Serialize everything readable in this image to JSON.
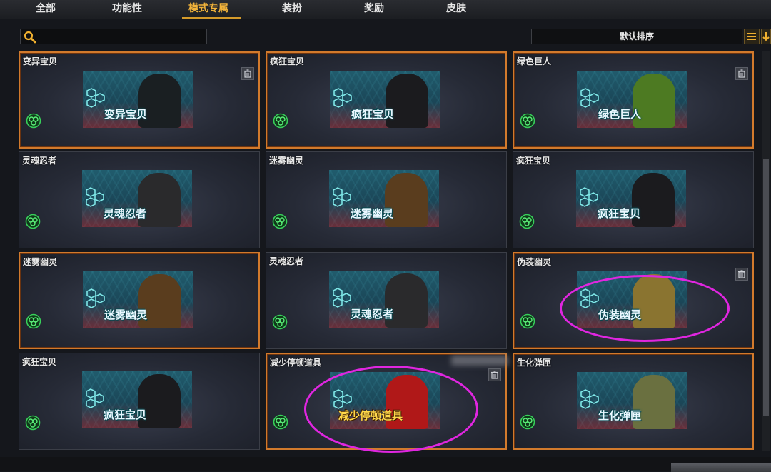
{
  "tabs": [
    {
      "label": "全部"
    },
    {
      "label": "功能性"
    },
    {
      "label": "模式专属",
      "active": true
    },
    {
      "label": "装扮"
    },
    {
      "label": "奖励"
    },
    {
      "label": "皮肤"
    }
  ],
  "search": {
    "value": "",
    "icon": "search-icon"
  },
  "sort": {
    "label": "默认排序"
  },
  "cards": [
    {
      "title": "变异宝贝",
      "art_label": "变异宝贝",
      "selected": true,
      "trash": true,
      "figure_color": "#1a1f22"
    },
    {
      "title": "疯狂宝贝",
      "art_label": "疯狂宝贝",
      "selected": true,
      "trash": false,
      "figure_color": "#1b1b1e"
    },
    {
      "title": "绿色巨人",
      "art_label": "绿色巨人",
      "selected": true,
      "trash": true,
      "figure_color": "#4d7a22"
    },
    {
      "title": "灵魂忍者",
      "art_label": "灵魂忍者",
      "selected": false,
      "trash": false,
      "figure_color": "#2a2a2c"
    },
    {
      "title": "迷雾幽灵",
      "art_label": "迷雾幽灵",
      "selected": false,
      "trash": false,
      "figure_color": "#5a3d1e"
    },
    {
      "title": "疯狂宝贝",
      "art_label": "疯狂宝贝",
      "selected": false,
      "trash": false,
      "figure_color": "#1b1b1e"
    },
    {
      "title": "迷雾幽灵",
      "art_label": "迷雾幽灵",
      "selected": true,
      "trash": false,
      "figure_color": "#5a3d1e"
    },
    {
      "title": "灵魂忍者",
      "art_label": "灵魂忍者",
      "selected": false,
      "trash": false,
      "figure_color": "#2a2a2c"
    },
    {
      "title": "伪装幽灵",
      "art_label": "伪装幽灵",
      "selected": true,
      "trash": true,
      "figure_color": "#8a7430"
    },
    {
      "title": "疯狂宝贝",
      "art_label": "疯狂宝贝",
      "selected": false,
      "trash": false,
      "figure_color": "#1b1b1e"
    },
    {
      "title": "减少停顿道具",
      "art_label": "减少停顿道具",
      "selected": true,
      "trash": true,
      "figure_color": "#b01818"
    },
    {
      "title": "生化弹匣",
      "art_label": "生化弹匣",
      "selected": true,
      "trash": false,
      "figure_color": "#6a7040"
    }
  ],
  "colors": {
    "accent": "#f2b33a",
    "selected_border": "#d27a2c",
    "annotation": "#e026e0"
  }
}
